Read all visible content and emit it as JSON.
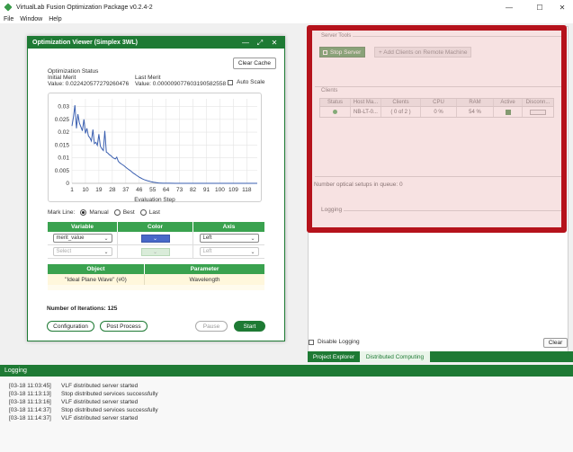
{
  "app": {
    "title": "VirtualLab Fusion Optimization Package v0.2.4-2",
    "controls": [
      "—",
      "☐",
      "✕"
    ]
  },
  "menu": [
    "File",
    "Window",
    "Help"
  ],
  "right": {
    "server_tools_label": "Server Tools",
    "stop_server": "Stop Server",
    "add_clients": "+ Add Clients on Remote Machine",
    "clients_label": "Clients",
    "clients_columns": [
      "Status",
      "Host Ma...",
      "Clients",
      "CPU",
      "RAM",
      "Active",
      "Disconn..."
    ],
    "clients_rows": [
      {
        "status": "online",
        "host": "NB-LT-0...",
        "clients": "( 0 of 2 )",
        "cpu": "0 %",
        "ram": "54 %",
        "active": true
      }
    ],
    "queue_text": "Number optical setups in queue:  0",
    "logging_label": "Logging",
    "disable_logging": "Disable Logging",
    "clear": "Clear",
    "tabs": [
      "Project Explorer",
      "Distributed Computing"
    ]
  },
  "bottom_log": {
    "header": "Logging",
    "entries": [
      {
        "time": "[03-18 11:03:45]",
        "msg": "VLF distributed server started"
      },
      {
        "time": "[03-18 11:13:13]",
        "msg": "Stop distributed services successfully"
      },
      {
        "time": "[03-18 11:13:16]",
        "msg": "VLF distributed server started"
      },
      {
        "time": "[03-18 11:14:37]",
        "msg": "Stop distributed services successfully"
      },
      {
        "time": "[03-18 11:14:37]",
        "msg": "VLF distributed server started"
      }
    ]
  },
  "viewer": {
    "title": "Optimization Viewer (Simplex 3WL)",
    "clear_cache": "Clear Cache",
    "status_label": "Optimization Status",
    "initial_merit_label": "Initial Merit",
    "initial_merit_value": "Value:  0.022420577279260476",
    "last_merit_label": "Last Merit",
    "last_merit_value": "Value:  0.000009077603190582558",
    "auto_scale": "Auto Scale",
    "mark_line_label": "Mark Line:",
    "mark_line_options": [
      "Manual",
      "Best",
      "Last"
    ],
    "mark_line_selected": "Manual",
    "var_columns": [
      "Variable",
      "Color",
      "Axis"
    ],
    "var_rows": [
      {
        "variable": "merit_value",
        "color": "#4868c8",
        "axis": "Left",
        "enabled": true
      },
      {
        "variable": "Select",
        "color": "#d9ecd9",
        "axis": "Left",
        "enabled": false
      }
    ],
    "obj_columns": [
      "Object",
      "Parameter"
    ],
    "obj_rows": [
      {
        "object": "\"Ideal Plane Wave\" (#0)",
        "parameter": "Wavelength"
      }
    ],
    "iterations": "Number of Iterations: 125",
    "buttons": {
      "configuration": "Configuration",
      "post_process": "Post Process",
      "pause": "Pause",
      "start": "Start"
    }
  },
  "chart_data": {
    "type": "line",
    "xlabel": "Evaluation Step",
    "ylabel": "",
    "x_ticks": [
      1,
      10,
      19,
      28,
      37,
      46,
      55,
      64,
      73,
      82,
      91,
      100,
      109,
      118
    ],
    "y_ticks": [
      0,
      0.005,
      0.01,
      0.015,
      0.02,
      0.025,
      0.03
    ],
    "y_tick_labels": [
      "0",
      "0.005",
      "0.01",
      "0.015",
      "0.02",
      "0.025",
      "0.03"
    ],
    "xlim": [
      1,
      125
    ],
    "ylim": [
      0,
      0.033
    ],
    "series": [
      {
        "color": "#3a5fb0",
        "x": [
          1,
          2,
          3,
          4,
          5,
          6,
          7,
          8,
          9,
          10,
          11,
          12,
          13,
          14,
          15,
          16,
          17,
          18,
          19,
          20,
          21,
          22,
          23,
          24,
          25,
          26,
          27,
          28,
          29,
          30,
          31,
          32,
          33,
          34,
          35,
          36,
          37,
          38,
          39,
          40,
          41,
          42,
          43,
          44,
          45,
          46,
          47,
          48,
          49,
          50,
          51,
          52,
          53,
          54,
          55,
          56,
          57,
          58,
          59,
          60,
          62,
          64,
          66,
          70,
          75,
          80,
          90,
          100,
          110,
          125
        ],
        "y": [
          0.0224,
          0.026,
          0.0305,
          0.0215,
          0.027,
          0.0235,
          0.022,
          0.0205,
          0.025,
          0.0195,
          0.0215,
          0.0185,
          0.0178,
          0.0165,
          0.021,
          0.0155,
          0.016,
          0.0148,
          0.0192,
          0.0145,
          0.0135,
          0.0128,
          0.0205,
          0.0122,
          0.0118,
          0.0112,
          0.0108,
          0.0102,
          0.0098,
          0.0095,
          0.0102,
          0.0086,
          0.008,
          0.0076,
          0.0072,
          0.0068,
          0.0063,
          0.0058,
          0.0054,
          0.005,
          0.0045,
          0.004,
          0.0036,
          0.0032,
          0.0028,
          0.0024,
          0.0021,
          0.0018,
          0.0015,
          0.0013,
          0.0011,
          0.0009,
          0.0008,
          0.0006,
          0.0005,
          0.0004,
          0.0003,
          0.0002,
          0.00015,
          0.0001,
          5e-05,
          3e-05,
          2e-05,
          1e-05,
          1e-05,
          1e-05,
          1e-05,
          1e-05,
          1e-05,
          1e-05
        ]
      }
    ]
  }
}
